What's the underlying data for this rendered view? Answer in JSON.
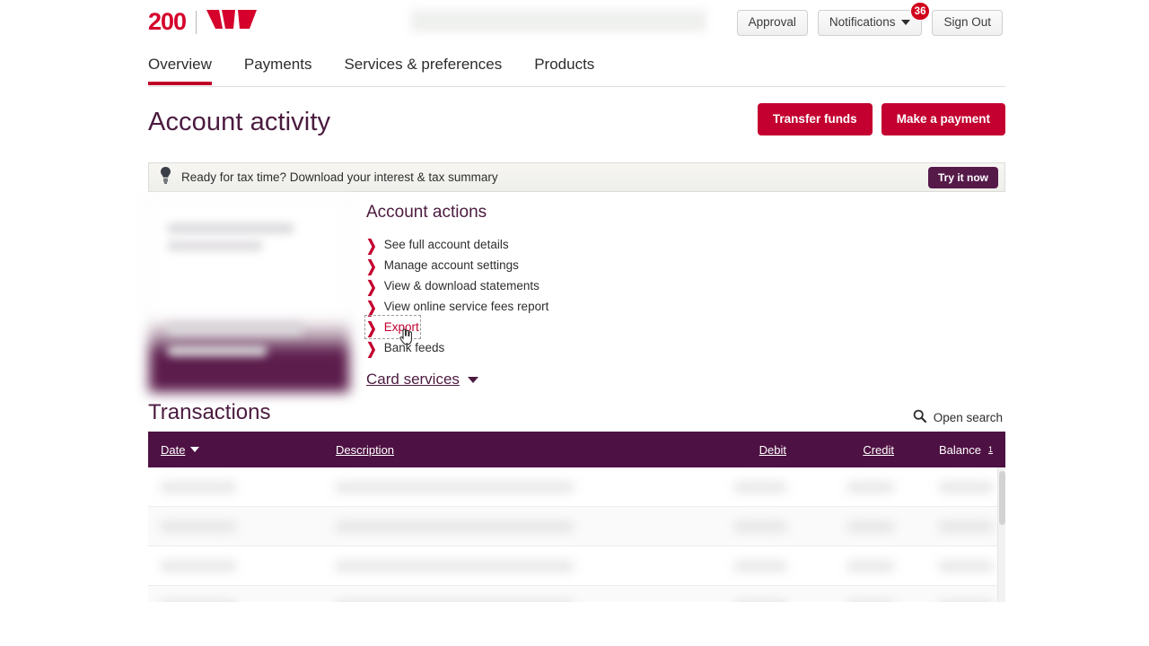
{
  "brand": {
    "anniversary_mark": "200",
    "logo_name": "westpac-w-logo",
    "accent_red": "#C3002F",
    "plum": "#4E1143",
    "title_plum": "#4B1B3F"
  },
  "header": {
    "redacted_region": "",
    "buttons": [
      {
        "label": "Approval",
        "name": "approval-button"
      },
      {
        "label": "Notifications",
        "name": "notifications-button",
        "badge": "36",
        "has_chevron": true
      },
      {
        "label": "Sign Out",
        "name": "sign-out-button"
      }
    ]
  },
  "nav": {
    "tabs": [
      {
        "label": "Overview",
        "active": true
      },
      {
        "label": "Payments",
        "active": false
      },
      {
        "label": "Services & preferences",
        "active": false
      },
      {
        "label": "Products",
        "active": false
      }
    ]
  },
  "title": {
    "heading": "Account activity",
    "actions": [
      {
        "label": "Transfer funds",
        "name": "transfer-funds-button"
      },
      {
        "label": "Make a payment",
        "name": "make-a-payment-button"
      }
    ]
  },
  "banner": {
    "icon": "lightbulb-icon",
    "text": "Ready for tax time? Download your interest & tax summary",
    "cta_label": "Try it now"
  },
  "account_card": {
    "redacted": true
  },
  "account_actions": {
    "title": "Account actions",
    "items": [
      {
        "label": "See full account details",
        "focused": false
      },
      {
        "label": "Manage account settings",
        "focused": false
      },
      {
        "label": "View & download statements",
        "focused": false
      },
      {
        "label": "View online service fees report",
        "focused": false
      },
      {
        "label": "Export",
        "focused": true
      },
      {
        "label": "Bank feeds",
        "focused": false
      }
    ],
    "card_services_label": "Card services"
  },
  "transactions": {
    "title": "Transactions",
    "open_search_label": "Open search",
    "search_icon": "magnifier-icon",
    "columns": [
      {
        "label": "Date",
        "sorted": true,
        "sort_dir": "desc"
      },
      {
        "label": "Description",
        "sorted": false
      },
      {
        "label": "Debit",
        "sorted": false
      },
      {
        "label": "Credit",
        "sorted": false
      },
      {
        "label": "Balance",
        "sorted": false,
        "superscript": "1"
      }
    ],
    "rows_redacted": true,
    "row_count": 4
  },
  "cursor": {
    "type": "pointing-hand",
    "over_element": "Export"
  }
}
